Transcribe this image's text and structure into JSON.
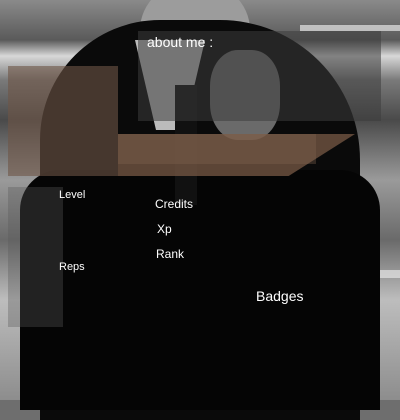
{
  "about": {
    "label": "about me :"
  },
  "stats": {
    "level": "Level",
    "reps": "Reps",
    "credits": "Credits",
    "xp": "Xp",
    "rank": "Rank"
  },
  "badges": {
    "label": "Badges"
  },
  "colors": {
    "brown_overlay": "#6e5546",
    "text": "#ffffff"
  }
}
